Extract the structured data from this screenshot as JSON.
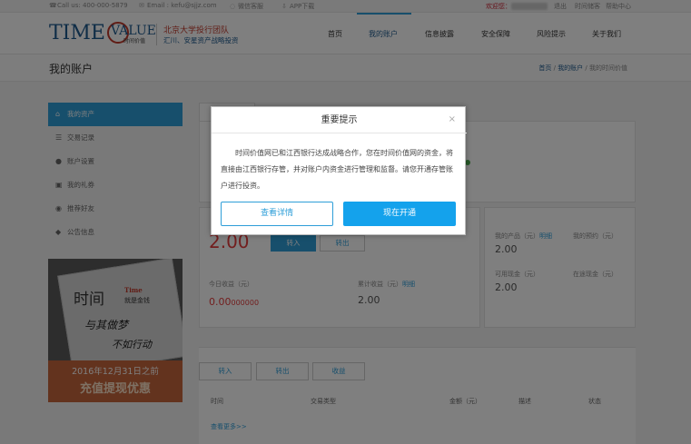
{
  "topbar": {
    "phone": "Call us: 400-000-5879",
    "email": "Email : kefu@sjjz.com",
    "wechat": "微信客服",
    "app": "APP下载",
    "welcome": "欢迎您：",
    "logout": "退出",
    "site": "时间储客",
    "help": "帮助中心"
  },
  "header": {
    "logo_main": "TIME",
    "logo_v": "ALUE",
    "logo_sub": "时间价值",
    "tagline1": "北京大学投行团队",
    "tagline2": "汇川、安星资产战略投资",
    "nav": [
      "首页",
      "我的账户",
      "信息披露",
      "安全保障",
      "风险提示",
      "关于我们"
    ]
  },
  "breadcrumb": {
    "title": "我的账户",
    "home": "首页",
    "account": "我的账户",
    "current": "我的时间价值"
  },
  "sidebar": {
    "items": [
      {
        "icon": "home-icon",
        "label": "我的资产"
      },
      {
        "icon": "list-icon",
        "label": "交易记录"
      },
      {
        "icon": "user-icon",
        "label": "账户设置"
      },
      {
        "icon": "gift-icon",
        "label": "我的礼券"
      },
      {
        "icon": "users-icon",
        "label": "推荐好友"
      },
      {
        "icon": "bell-icon",
        "label": "公告信息"
      }
    ]
  },
  "promo": {
    "big": "时间",
    "time": "Time",
    "money": "就是金钱",
    "script1": "与其做梦",
    "script2": "不如行动",
    "date": "2016年12月31日之前",
    "offer": "充值提现优惠"
  },
  "assets": {
    "balance": "2.00",
    "btn_in": "转入",
    "btn_out": "转出",
    "today_label": "今日收益（元）",
    "today_value": "0.00",
    "today_small": "000000",
    "total_label": "累计收益（元）",
    "total_link": "明细",
    "total_value": "2.00",
    "product_label": "我的产品（元）",
    "product_link": "明细",
    "product_value": "2.00",
    "booking_label": "我的预约（元）",
    "available_label": "可用现金（元）",
    "available_value": "2.00",
    "transit_label": "在途现金（元）"
  },
  "records": {
    "tabs": [
      "转入",
      "转出",
      "收益"
    ],
    "columns": [
      "时间",
      "交易类型",
      "金额（元）",
      "描述",
      "状态"
    ],
    "more": "查看更多>>"
  },
  "modal": {
    "title": "重要提示",
    "close": "×",
    "body": "时间价值网已和江西银行达成战略合作，您在时间价值网的资金，将直接由江西银行存管，并对账户内资金进行管理和监督。请您开通存管账户进行投资。",
    "detail_btn": "查看详情",
    "open_btn": "现在开通"
  }
}
